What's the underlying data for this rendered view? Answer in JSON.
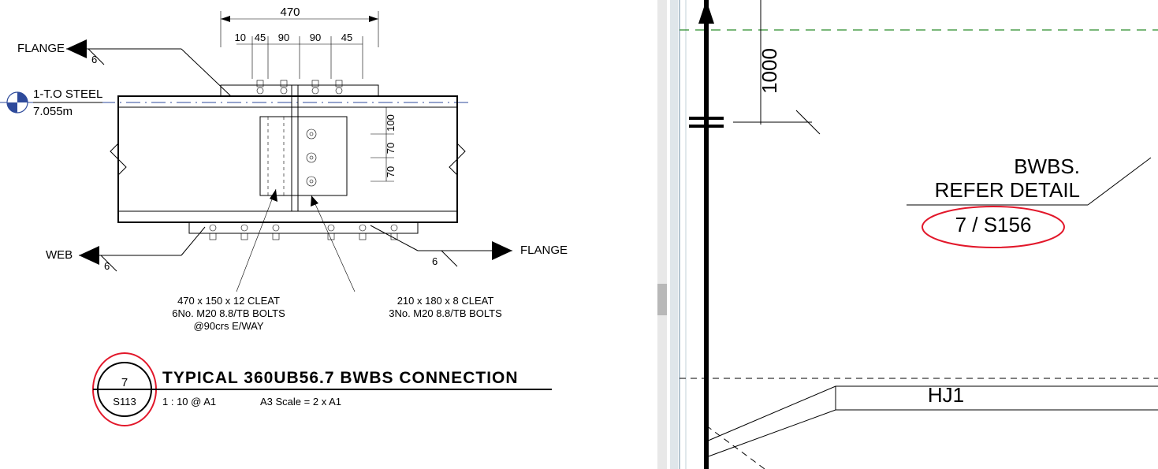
{
  "left": {
    "datum": {
      "label": "1-T.O STEEL",
      "value": "7.055m"
    },
    "flangeTag": {
      "label": "FLANGE",
      "size": "6"
    },
    "webTag": {
      "label": "WEB",
      "size": "6"
    },
    "flangeTag2": {
      "label": "FLANGE",
      "size": "6"
    },
    "dims": {
      "overall": "470",
      "ten": "10",
      "d1": "45",
      "d2": "90",
      "d3": "90",
      "d4": "45",
      "v100": "100",
      "v70a": "70",
      "v70b": "70"
    },
    "notes": {
      "cleat1_l1": "470 x 150 x 12 CLEAT",
      "cleat1_l2": "6No. M20 8.8/TB BOLTS",
      "cleat1_l3": "@90crs E/WAY",
      "cleat2_l1": "210 x 180 x 8 CLEAT",
      "cleat2_l2": "3No. M20 8.8/TB BOLTS"
    },
    "title": {
      "num": "7",
      "sheet": "S113",
      "name": "TYPICAL 360UB56.7 BWBS CONNECTION",
      "scaleA": "1 : 10 @ A1",
      "scaleB": "A3  Scale = 2 x A1"
    }
  },
  "right": {
    "dim1000": "1000",
    "callout_l1": "BWBS.",
    "callout_l2": "REFER DETAIL",
    "callout_ref": "7 / S156",
    "label_hj1": "HJ1"
  }
}
